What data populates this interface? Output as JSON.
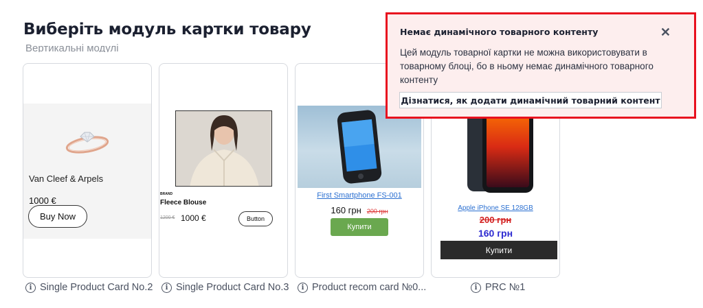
{
  "page": {
    "title": "Виберіть модуль картки товару",
    "section_label": "Вертикальні модулі"
  },
  "cards": [
    {
      "caption": "Single Product Card No.2",
      "product_name": "Van Cleef & Arpels",
      "price": "1000 €",
      "button_label": "Buy Now"
    },
    {
      "caption": "Single Product Card No.3",
      "brand": "BRAND",
      "product_name": "Fleece Blouse",
      "old_price": "1200 €",
      "price": "1000 €",
      "button_label": "Button"
    },
    {
      "caption": "Product recom card №0...",
      "product_name": "First Smartphone FS-001",
      "price": "160 грн",
      "old_price": "200 грн",
      "button_label": "Купити",
      "button_color": "#6aa84f"
    },
    {
      "caption": "PRC №1",
      "product_name": "Apple iPhone SE 128GB",
      "old_price": "200 грн",
      "price": "160 грн",
      "button_label": "Купити",
      "price_color": "#2d2ad1",
      "old_price_color": "#d31f1f"
    }
  ],
  "alert": {
    "title": "Немає динамічного товарного контенту",
    "body": "Цей модуль товарної картки не можна використовувати в товарному блоці, бо в ньому немає динамічного товарного контенту",
    "action_label": "Дізнатися, як додати динамічний товарний контент",
    "close_icon": "close-icon",
    "border_color": "#e8101e",
    "background_color": "#fdeeee"
  },
  "icons": {
    "info": "info-icon"
  }
}
